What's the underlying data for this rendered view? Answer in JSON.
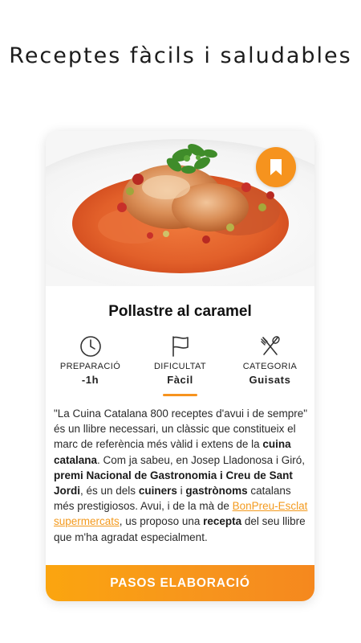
{
  "header": {
    "title": "Receptes fàcils i saludables"
  },
  "recipe": {
    "title": "Pollastre al caramel",
    "bookmark_icon": "bookmark-icon",
    "meta": [
      {
        "icon": "clock-icon",
        "label": "PREPARACIÓ",
        "value": "-1h"
      },
      {
        "icon": "flag-icon",
        "label": "DIFICULTAT",
        "value": "Fàcil"
      },
      {
        "icon": "utensils-icon",
        "label": "CATEGORIA",
        "value": "Guisats"
      }
    ],
    "description": {
      "p1": "\"La Cuina Catalana 800 receptes d'avui i de sempre\" és un llibre necessari, un clàssic que constitueix el marc de referència més vàlid i extens de la ",
      "b1": "cuina catalana",
      "p2": ". Com ja sabeu, en Josep Lladonosa i Giró, ",
      "b2": "premi Nacional de Gastronomia i Creu de Sant Jordi",
      "p3": ", és un dels ",
      "b3": "cuiners",
      "p4": " i ",
      "b4": "gastrònoms",
      "p5": " catalans més prestigiosos. Avui, i de la mà de ",
      "link": "BonPreu-Esclat supermercats",
      "p6": ", us proposo una ",
      "b5": "recepta",
      "p7": " del seu llibre que m'ha agradat especialment."
    },
    "steps_button": "PASOS ELABORACIÓ"
  },
  "colors": {
    "accent": "#f6931e",
    "link": "#f39a1e"
  }
}
